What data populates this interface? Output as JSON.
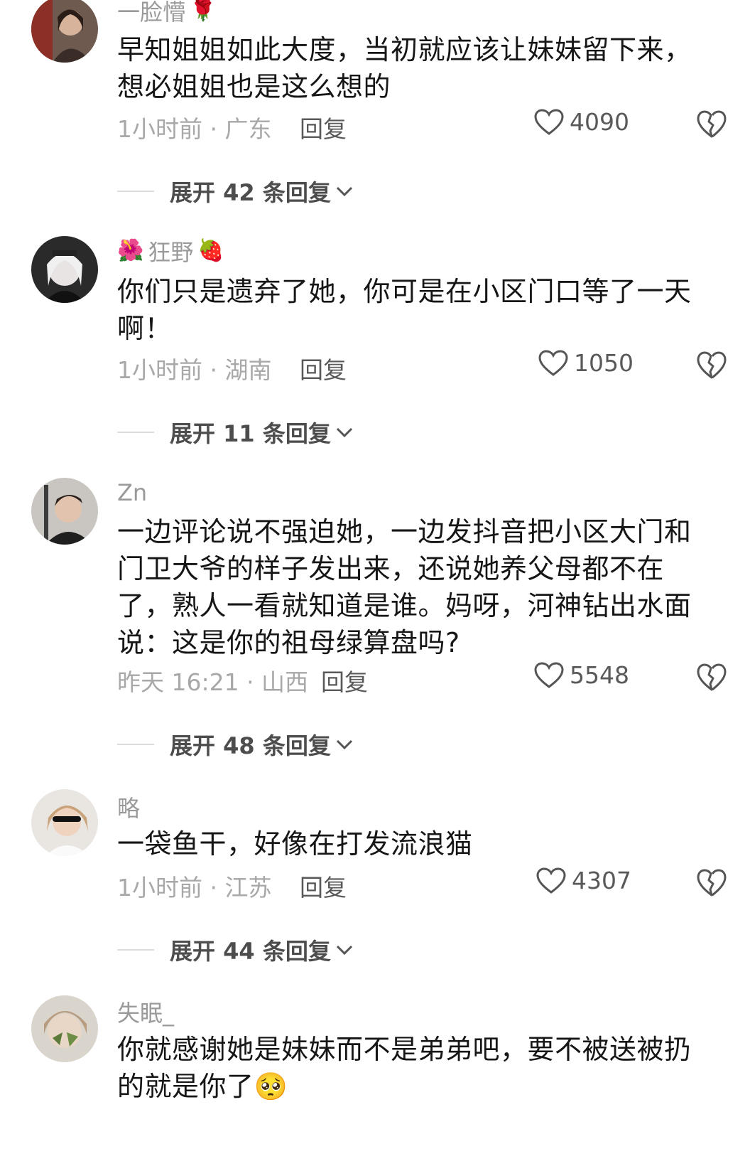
{
  "comments": [
    {
      "username": "一脸懵",
      "badge_after": "🌹",
      "text": "早知姐姐如此大度，当初就应该让妹妹留下来，想必姐姐也是这么想的",
      "meta": "1小时前 · 广东",
      "reply": "回复",
      "likes": "4090",
      "expand": "展开 42 条回复"
    },
    {
      "username": "狂野",
      "badge_before": "🌺",
      "badge_after": "🍓",
      "text": "你们只是遗弃了她，你可是在小区门口等了一天啊！",
      "meta": "1小时前 · 湖南",
      "reply": "回复",
      "likes": "1050",
      "expand": "展开 11 条回复"
    },
    {
      "username": "Zn",
      "text": "一边评论说不强迫她，一边发抖音把小区大门和门卫大爷的样子发出来，还说她养父母都不在了，熟人一看就知道是谁。妈呀，河神钻出水面说：这是你的祖母绿算盘吗?",
      "meta": "昨天 16:21 · 山西",
      "reply": "回复",
      "likes": "5548",
      "expand": "展开 48 条回复"
    },
    {
      "username": "略",
      "text": "一袋鱼干，好像在打发流浪猫",
      "meta": "1小时前 · 江苏",
      "reply": "回复",
      "likes": "4307",
      "expand": "展开 44 条回复"
    },
    {
      "username": "失眠_",
      "text": "你就感谢她是妹妹而不是弟弟吧，要不被送被扔的就是你了",
      "text_emoji": "🥺"
    }
  ],
  "icons": {
    "like": "heart-outline-icon",
    "dislike": "broken-heart-icon",
    "expand": "chevron-down-icon"
  }
}
